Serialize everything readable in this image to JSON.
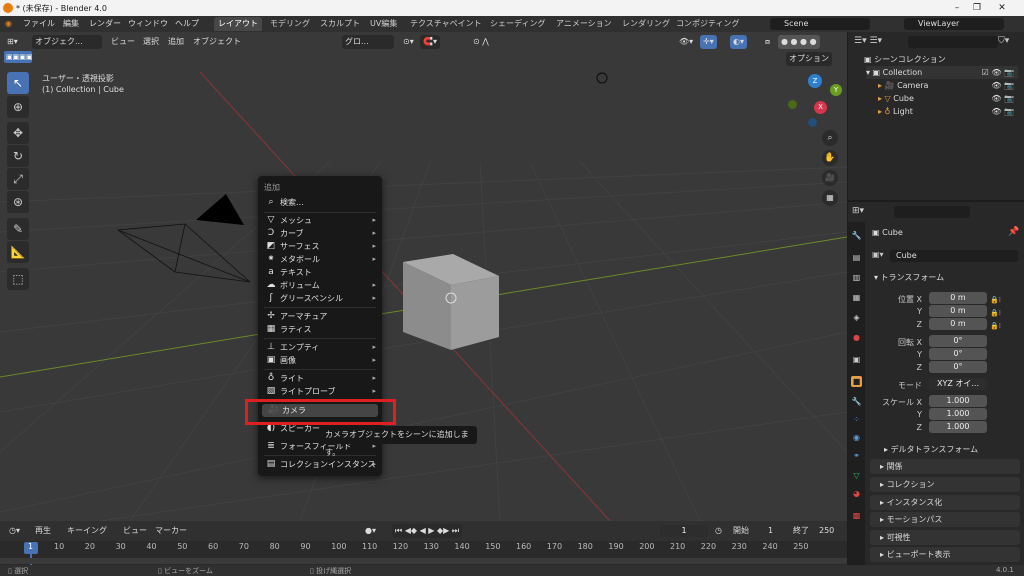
{
  "window": {
    "title": "* (未保存) - Blender 4.0",
    "controls": [
      "–",
      "❐",
      "✕"
    ]
  },
  "menubar": {
    "menus": [
      "ファイル",
      "編集",
      "レンダー",
      "ウィンドウ",
      "ヘルプ"
    ],
    "workspaces": [
      "レイアウト",
      "モデリング",
      "スカルプト",
      "UV編集",
      "テクスチャペイント",
      "シェーディング",
      "アニメーション",
      "レンダリング",
      "コンポジティング"
    ],
    "active_workspace": "レイアウト",
    "scene": "Scene",
    "view_layer": "ViewLayer"
  },
  "viewport_header": {
    "mode": "オブジェク...",
    "menus": [
      "ビュー",
      "選択",
      "追加",
      "オブジェクト"
    ],
    "transform_orientation": "グロ...",
    "options_label": "オプション"
  },
  "viewport": {
    "view_name": "ユーザー・透視投影",
    "context": "(1) Collection | Cube",
    "gizmo_axes": [
      "Z",
      "Y",
      "X"
    ]
  },
  "add_menu": {
    "title": "追加",
    "items": [
      {
        "icon": "search-icon",
        "label": "検索..."
      },
      {
        "icon": "mesh-icon",
        "label": "メッシュ",
        "submenu": true
      },
      {
        "icon": "curve-icon",
        "label": "カーブ",
        "submenu": true
      },
      {
        "icon": "surface-icon",
        "label": "サーフェス",
        "submenu": true
      },
      {
        "icon": "metaball-icon",
        "label": "メタボール",
        "submenu": true
      },
      {
        "icon": "text-icon",
        "label": "テキスト"
      },
      {
        "icon": "volume-icon",
        "label": "ボリューム",
        "submenu": true
      },
      {
        "icon": "grease-pencil-icon",
        "label": "グリースペンシル",
        "submenu": true
      },
      {
        "icon": "armature-icon",
        "label": "アーマチュア"
      },
      {
        "icon": "lattice-icon",
        "label": "ラティス"
      },
      {
        "icon": "empty-icon",
        "label": "エンプティ",
        "submenu": true
      },
      {
        "icon": "image-icon",
        "label": "画像",
        "submenu": true
      },
      {
        "icon": "light-icon",
        "label": "ライト",
        "submenu": true
      },
      {
        "icon": "light-probe-icon",
        "label": "ライトプローブ",
        "submenu": true
      },
      {
        "icon": "camera-icon",
        "label": "カメラ",
        "highlighted": true
      },
      {
        "icon": "speaker-icon",
        "label": "スピーカー"
      },
      {
        "icon": "force-field-icon",
        "label": "フォースフィールド",
        "submenu": true
      },
      {
        "icon": "collection-instance-icon",
        "label": "コレクションインスタンス",
        "submenu": true
      }
    ],
    "tooltip": "カメラオブジェクトをシーンに追加します。"
  },
  "outliner": {
    "root": "シーンコレクション",
    "collection": "Collection",
    "objects": [
      "Camera",
      "Cube",
      "Light"
    ]
  },
  "properties": {
    "object_name": "Cube",
    "object_field": "Cube",
    "transform_title": "トランスフォーム",
    "location_label": "位置 X",
    "rotation_label": "回転 X",
    "mode_label": "モード",
    "mode_value": "XYZ オイ...",
    "scale_label": "スケール X",
    "axis_y": "Y",
    "axis_z": "Z",
    "location": [
      "0 m",
      "0 m",
      "0 m"
    ],
    "rotation": [
      "0°",
      "0°",
      "0°"
    ],
    "scale": [
      "1.000",
      "1.000",
      "1.000"
    ],
    "panels": [
      "デルタトランスフォーム",
      "関係",
      "コレクション",
      "インスタンス化",
      "モーションパス",
      "可視性",
      "ビューポート表示"
    ]
  },
  "timeline": {
    "menus": [
      "再生",
      "キーイング",
      "ビュー",
      "マーカー"
    ],
    "current_frame": "1",
    "start_label": "開始",
    "start": "1",
    "end_label": "終了",
    "end": "250",
    "ticks": [
      "1",
      "10",
      "20",
      "30",
      "40",
      "50",
      "60",
      "70",
      "80",
      "90",
      "100",
      "110",
      "120",
      "130",
      "140",
      "150",
      "160",
      "170",
      "180",
      "190",
      "200",
      "210",
      "220",
      "230",
      "240",
      "250"
    ]
  },
  "statusbar": {
    "select": "選択",
    "zoom": "ビューをズーム",
    "lasso": "投げ縄選択",
    "version": "4.0.1"
  }
}
